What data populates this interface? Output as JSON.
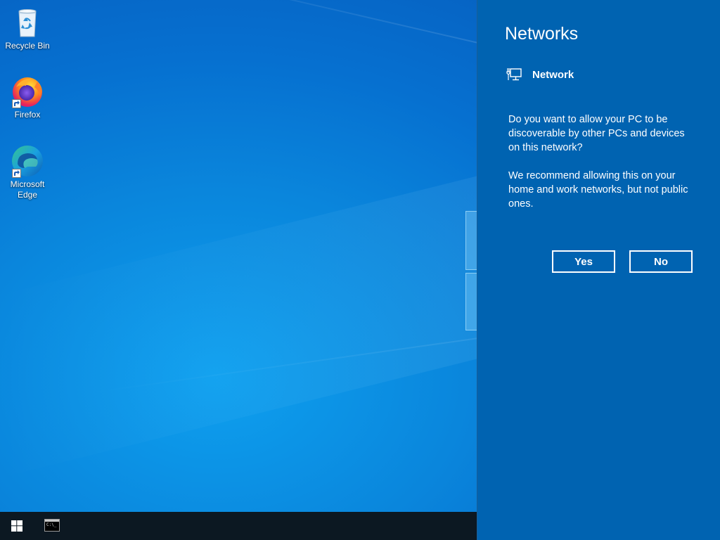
{
  "desktop": {
    "icons": [
      {
        "label": "Recycle Bin",
        "icon": "recycle-bin-icon"
      },
      {
        "label": "Firefox",
        "icon": "firefox-icon"
      },
      {
        "label": "Microsoft Edge",
        "icon": "edge-icon"
      }
    ]
  },
  "taskbar": {
    "start_icon": "windows-logo-icon",
    "apps": [
      {
        "icon": "command-prompt-icon"
      }
    ]
  },
  "flyout": {
    "title": "Networks",
    "network_icon": "wired-network-icon",
    "network_name": "Network",
    "question": "Do you want to allow your PC to be discoverable by other PCs and devices on this network?",
    "recommendation": "We recommend allowing this on your home and work networks, but not public ones.",
    "yes_label": "Yes",
    "no_label": "No",
    "background_color": "#0063b1"
  }
}
